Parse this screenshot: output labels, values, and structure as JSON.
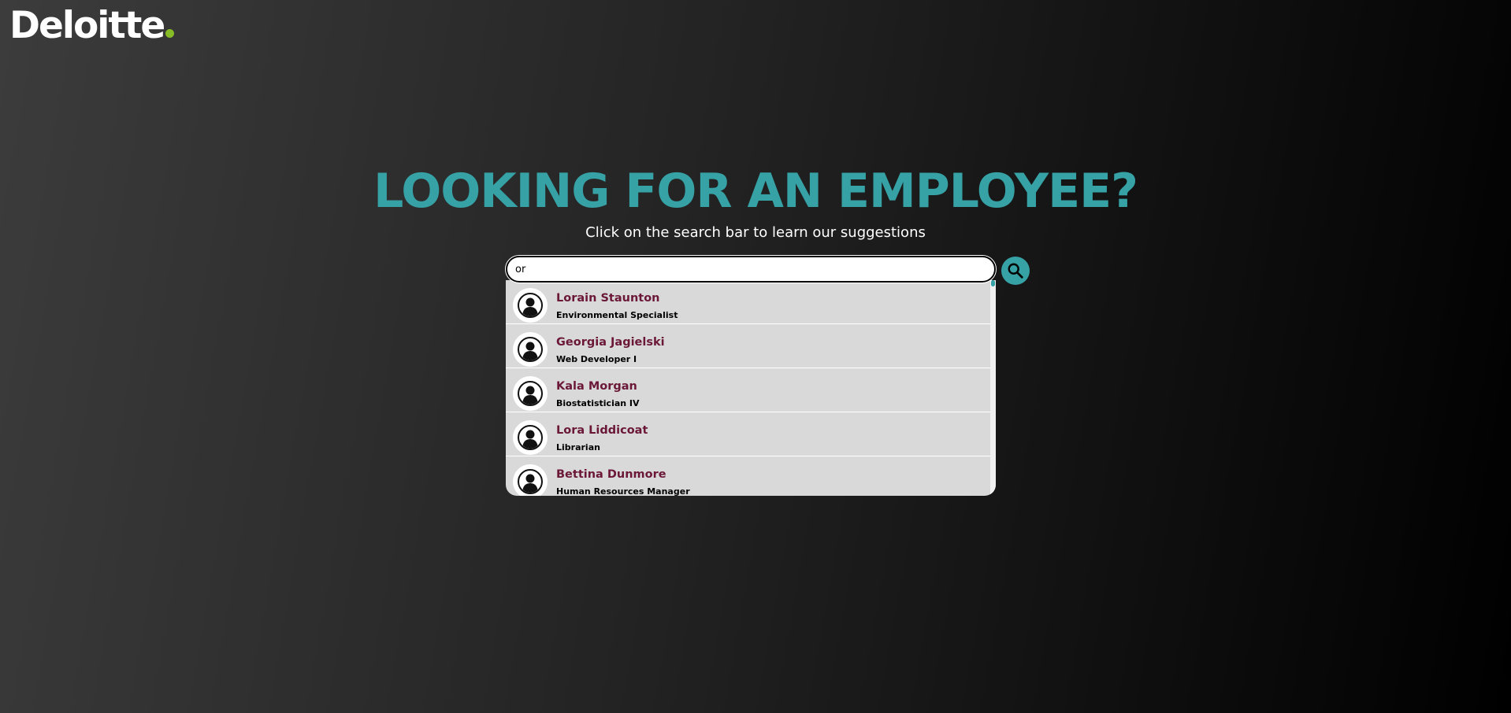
{
  "brand": {
    "logo_text": "Deloitte",
    "logo_dot_color": "#86bc25"
  },
  "hero": {
    "title": "LOOKING FOR AN EMPLOYEE?",
    "subtitle": "Click on the search bar to learn our suggestions",
    "title_color": "#36a2a6"
  },
  "search": {
    "value": "or",
    "button_icon": "search-icon"
  },
  "suggestions": [
    {
      "name": "Lorain Staunton",
      "role": "Environmental Specialist",
      "icon": "user-avatar-icon"
    },
    {
      "name": "Georgia Jagielski",
      "role": "Web Developer I",
      "icon": "user-avatar-icon"
    },
    {
      "name": "Kala Morgan",
      "role": "Biostatistician IV",
      "icon": "user-avatar-icon"
    },
    {
      "name": "Lora Liddicoat",
      "role": "Librarian",
      "icon": "user-avatar-icon"
    },
    {
      "name": "Bettina Dunmore",
      "role": "Human Resources Manager",
      "icon": "user-avatar-icon"
    }
  ],
  "colors": {
    "accent": "#36a2a6",
    "name_text": "#6b1838",
    "dropdown_bg": "#d9d9d9"
  }
}
